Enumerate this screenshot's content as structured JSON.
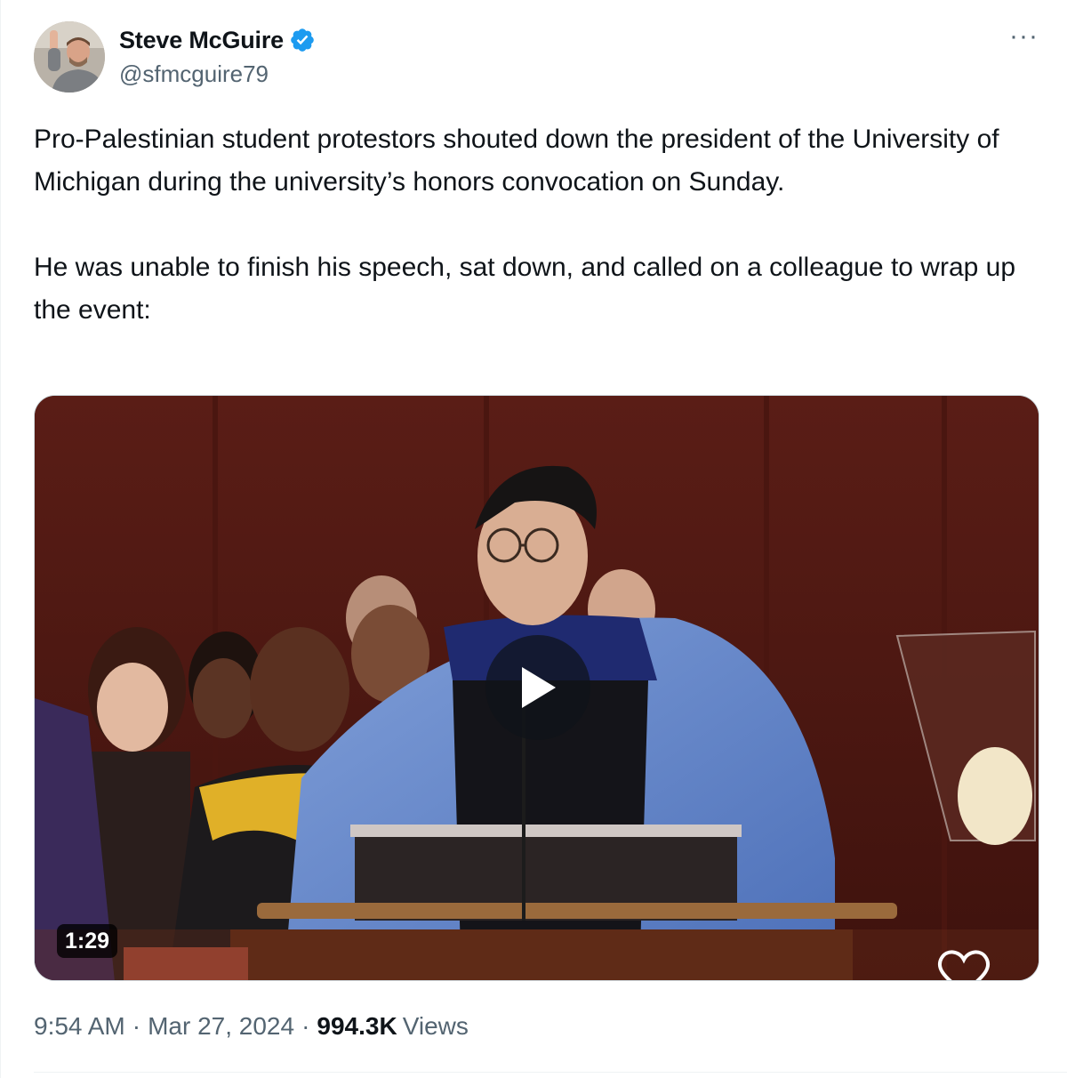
{
  "author": {
    "display_name": "Steve McGuire",
    "handle": "@sfmcguire79",
    "verified": true,
    "verified_color": "#1d9bf0"
  },
  "more_menu_label": "···",
  "tweet": {
    "paragraph_1": "Pro-Palestinian student protestors shouted down the president of the University of Michigan during the university’s honors convocation on Sunday.",
    "paragraph_2": "He was unable to finish his speech, sat down, and called on a colleague to wrap up the event:"
  },
  "media": {
    "type": "video",
    "duration": "1:29",
    "play_icon": "play-icon",
    "like_icon": "heart-outline-icon"
  },
  "meta": {
    "time": "9:54 AM",
    "separator": "·",
    "date": "Mar 27, 2024",
    "views_count": "994.3K",
    "views_label": "Views"
  },
  "colors": {
    "text_primary": "#0f1419",
    "text_secondary": "#536471",
    "border": "#cfd9de"
  }
}
